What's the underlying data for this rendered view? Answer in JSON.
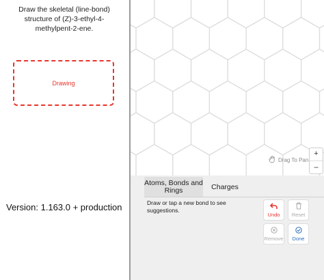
{
  "question": {
    "prompt": "Draw the skeletal (line-bond) structure of (Z)-3-ethyl-4-methylpent-2-ene.",
    "drawing_label": "Drawing"
  },
  "version": {
    "text": "Version: 1.163.0 +  production"
  },
  "canvas": {
    "drag_label": "Drag To Pan",
    "zoom_in": "+",
    "zoom_out": "–"
  },
  "panel": {
    "tabs": [
      {
        "label": "Atoms, Bonds and Rings",
        "active": true
      },
      {
        "label": "Charges",
        "active": false
      }
    ],
    "hint": "Draw or tap a new bond to see suggestions.",
    "buttons": {
      "undo": "Undo",
      "reset": "Reset",
      "remove": "Remove",
      "done": "Done"
    }
  },
  "colors": {
    "accent_red": "#e8332b",
    "accent_blue": "#2a6ebb",
    "grid": "#dcdcdc"
  }
}
